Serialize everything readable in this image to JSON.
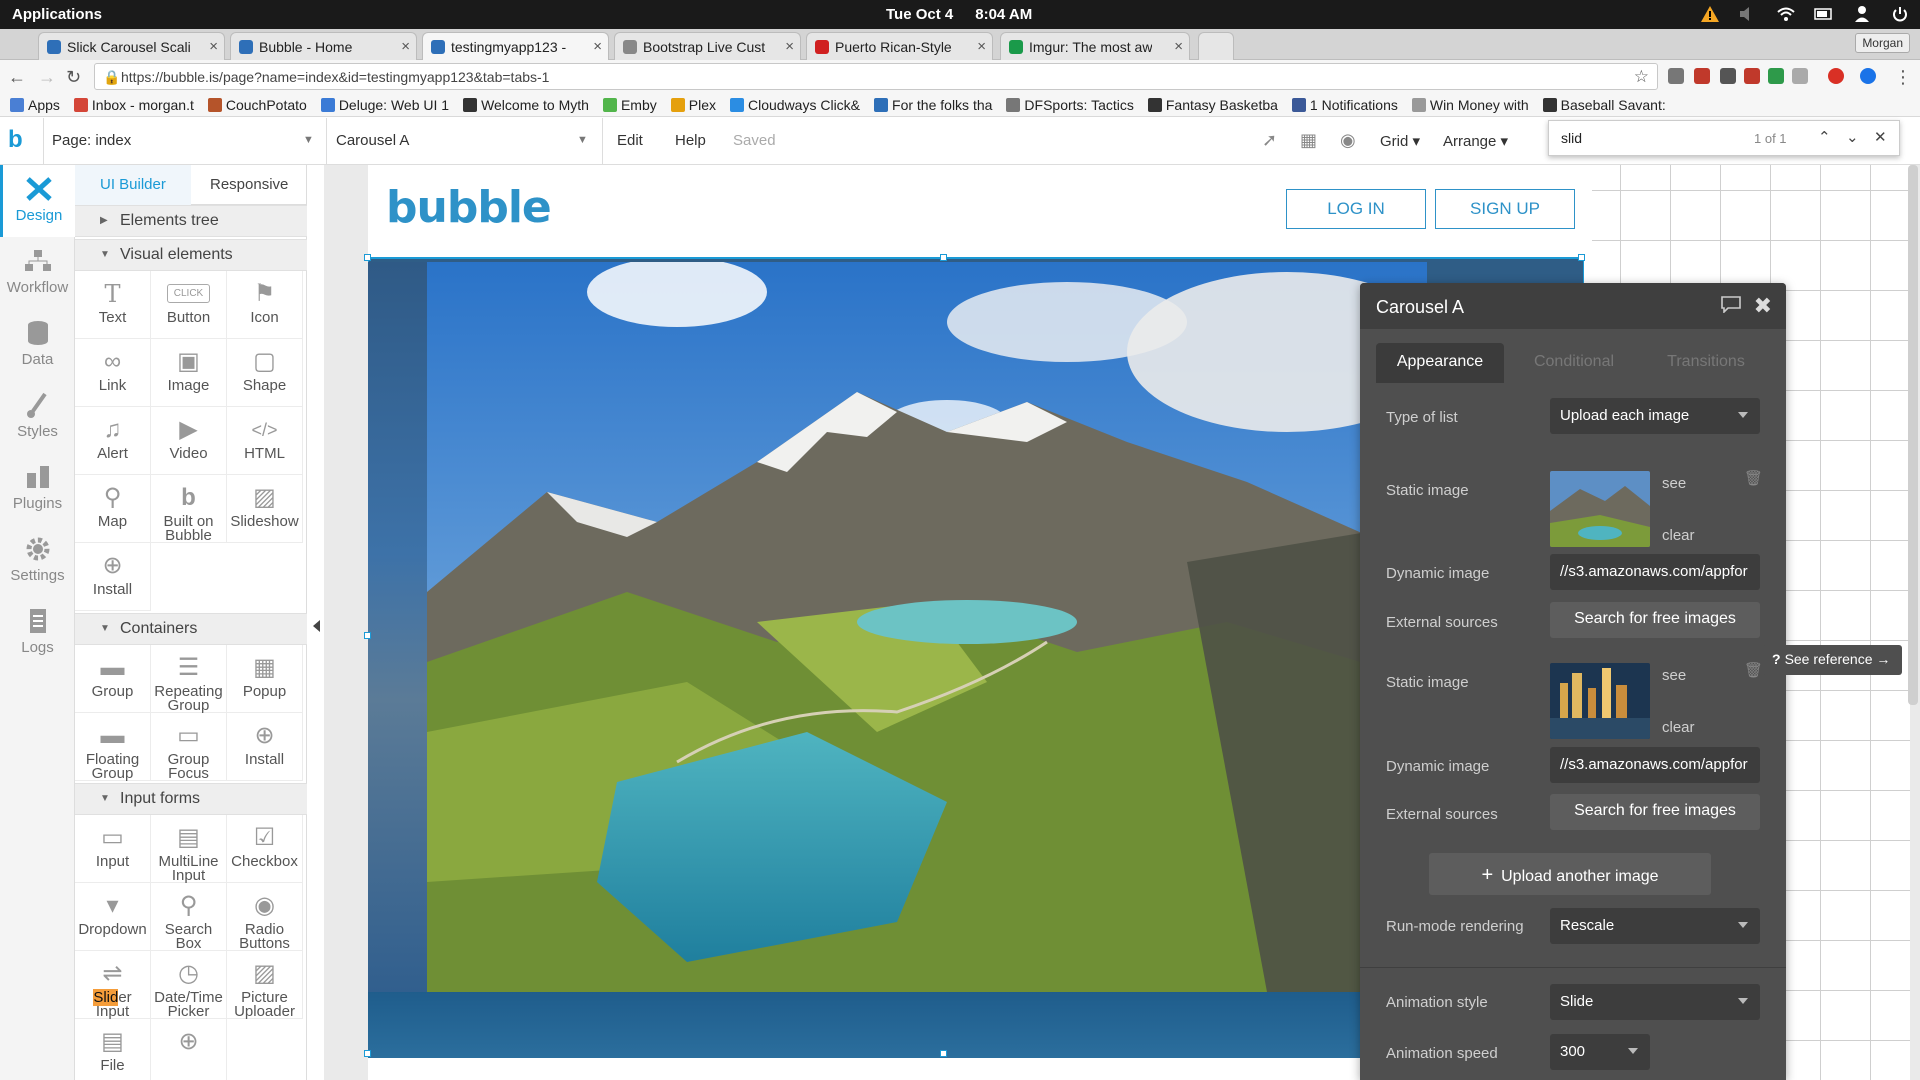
{
  "os": {
    "apps_label": "Applications",
    "date": "Tue Oct  4",
    "time": "8:04 AM"
  },
  "browser": {
    "tabs": [
      {
        "title": "Slick Carousel Scali",
        "favicon_color": "#2e6fb8"
      },
      {
        "title": "Bubble - Home",
        "favicon_color": "#2e6fb8"
      },
      {
        "title": "testingmyapp123 -",
        "favicon_color": "#2e6fb8"
      },
      {
        "title": "Bootstrap Live Cust",
        "favicon_color": "#888888"
      },
      {
        "title": "Puerto Rican-Style",
        "favicon_color": "#d02020"
      },
      {
        "title": "Imgur: The most aw",
        "favicon_color": "#1a9a4a"
      }
    ],
    "profile_name": "Morgan",
    "url": "https://bubble.is/page?name=index&id=testingmyapp123&tab=tabs-1",
    "bookmarks": [
      {
        "label": "Apps",
        "color": "#4a7fd4"
      },
      {
        "label": "Inbox - morgan.t",
        "color": "#d44638"
      },
      {
        "label": "CouchPotato",
        "color": "#b5542a"
      },
      {
        "label": "Deluge: Web UI 1",
        "color": "#3b7bd6"
      },
      {
        "label": "Welcome to Myth",
        "color": "#333333"
      },
      {
        "label": "Emby",
        "color": "#52b54b"
      },
      {
        "label": "Plex",
        "color": "#e5a00d"
      },
      {
        "label": "Cloudways Click&",
        "color": "#2b8de3"
      },
      {
        "label": "For the folks tha",
        "color": "#2e6fb8"
      },
      {
        "label": "DFSports: Tactics",
        "color": "#777777"
      },
      {
        "label": "Fantasy Basketba",
        "color": "#333333"
      },
      {
        "label": "1 Notifications",
        "color": "#3b5998"
      },
      {
        "label": "Win Money with",
        "color": "#999999"
      },
      {
        "label": "Baseball Savant:",
        "color": "#333333"
      }
    ]
  },
  "editor": {
    "page_label": "Page: index",
    "element_label": "Carousel A",
    "menu": [
      "Edit",
      "Help"
    ],
    "saved_label": "Saved",
    "grid_label": "Grid",
    "arrange_label": "Arrange",
    "find": {
      "query": "slid",
      "count": "1 of 1"
    }
  },
  "rail": [
    {
      "label": "Design",
      "icon": "design-icon"
    },
    {
      "label": "Workflow",
      "icon": "workflow-icon"
    },
    {
      "label": "Data",
      "icon": "data-icon"
    },
    {
      "label": "Styles",
      "icon": "styles-icon"
    },
    {
      "label": "Plugins",
      "icon": "plugins-icon"
    },
    {
      "label": "Settings",
      "icon": "settings-icon"
    },
    {
      "label": "Logs",
      "icon": "logs-icon"
    }
  ],
  "palette": {
    "tab_ui": "UI Builder",
    "tab_responsive": "Responsive",
    "elements_tree": "Elements tree",
    "visual_elements": "Visual elements",
    "containers": "Containers",
    "input_forms": "Input forms",
    "visual": [
      {
        "l1": "Text",
        "l2": "",
        "icon": "T"
      },
      {
        "l1": "Button",
        "l2": "",
        "icon": "CLICK"
      },
      {
        "l1": "Icon",
        "l2": "",
        "icon": "⚑"
      },
      {
        "l1": "Link",
        "l2": "",
        "icon": "🔗"
      },
      {
        "l1": "Image",
        "l2": "",
        "icon": "▣"
      },
      {
        "l1": "Shape",
        "l2": "",
        "icon": "▢"
      },
      {
        "l1": "Alert",
        "l2": "",
        "icon": "🔔"
      },
      {
        "l1": "Video",
        "l2": "",
        "icon": "▶"
      },
      {
        "l1": "HTML",
        "l2": "",
        "icon": "</>"
      },
      {
        "l1": "Map",
        "l2": "",
        "icon": "⚲"
      },
      {
        "l1": "Built on",
        "l2": "Bubble",
        "icon": "b"
      },
      {
        "l1": "Slideshow",
        "l2": "",
        "icon": "▨"
      },
      {
        "l1": "Install",
        "l2": "",
        "icon": "+"
      }
    ],
    "container_items": [
      {
        "l1": "Group",
        "l2": "",
        "icon": "▬"
      },
      {
        "l1": "Repeating",
        "l2": "Group",
        "icon": "☰"
      },
      {
        "l1": "Popup",
        "l2": "",
        "icon": "▦"
      },
      {
        "l1": "Floating",
        "l2": "Group",
        "icon": "▬"
      },
      {
        "l1": "Group",
        "l2": "Focus",
        "icon": "▭"
      },
      {
        "l1": "Install",
        "l2": "",
        "icon": "+"
      }
    ],
    "input_items": [
      {
        "l1": "Input",
        "l2": "",
        "icon": "▭"
      },
      {
        "l1": "MultiLine",
        "l2": "Input",
        "icon": "▤"
      },
      {
        "l1": "Checkbox",
        "l2": "",
        "icon": "☑"
      },
      {
        "l1": "Dropdown",
        "l2": "",
        "icon": "▾"
      },
      {
        "l1": "Search",
        "l2": "Box",
        "icon": "⚲"
      },
      {
        "l1": "Radio",
        "l2": "Buttons",
        "icon": "◉"
      },
      {
        "l1": "Slider",
        "l2": "Input",
        "icon": "⇌"
      },
      {
        "l1": "Date/Time",
        "l2": "Picker",
        "icon": "◷"
      },
      {
        "l1": "Picture",
        "l2": "Uploader",
        "icon": "▨"
      },
      {
        "l1": "File",
        "l2": "",
        "icon": "▤"
      },
      {
        "l1": "",
        "l2": "",
        "icon": "+"
      }
    ],
    "slider_highlight": "Slid",
    "slider_rest": "er"
  },
  "canvas": {
    "logo": "bubble",
    "login": "LOG IN",
    "signup": "SIGN UP"
  },
  "props": {
    "title": "Carousel A",
    "tabs": [
      "Appearance",
      "Conditional",
      "Transitions"
    ],
    "type_of_list_label": "Type of list",
    "type_of_list_value": "Upload each image",
    "static_image_label": "Static image",
    "see": "see",
    "clear": "clear",
    "dynamic_image_label": "Dynamic image",
    "dynamic_image_value": "//s3.amazonaws.com/appfor",
    "external_sources_label": "External sources",
    "search_free": "Search for free images",
    "upload_another": "Upload another image",
    "run_mode_label": "Run-mode rendering",
    "run_mode_value": "Rescale",
    "animation_style_label": "Animation style",
    "animation_style_value": "Slide",
    "animation_speed_label": "Animation speed",
    "animation_speed_value": "300",
    "see_reference": "See reference →"
  }
}
